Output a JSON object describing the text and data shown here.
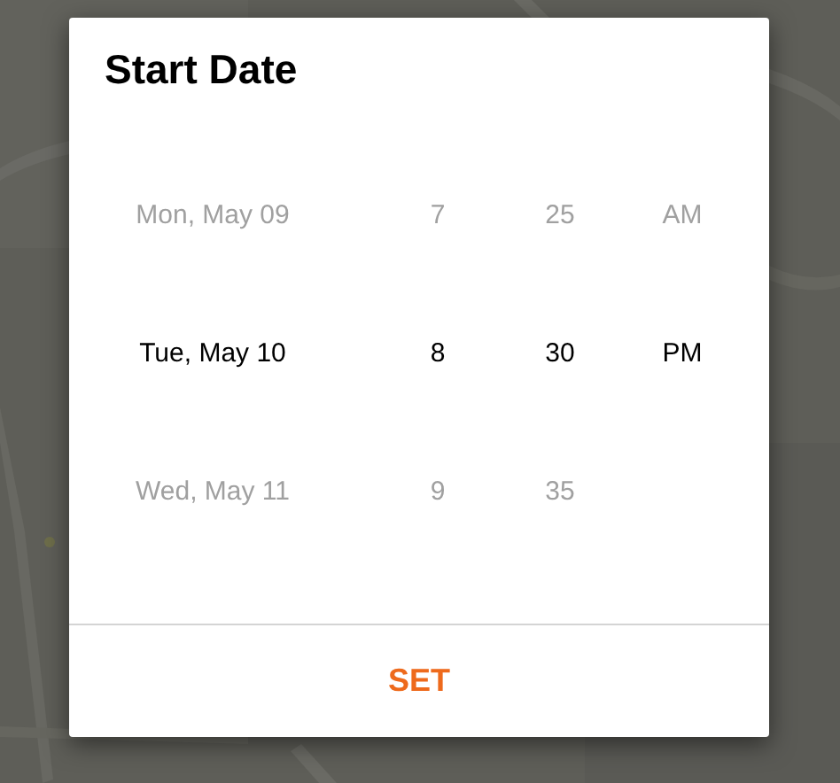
{
  "dialog": {
    "title": "Start Date",
    "picker_columns": [
      {
        "kind": "date",
        "items": [
          {
            "label": "Mon, May 09",
            "selected": false
          },
          {
            "label": "Tue, May 10",
            "selected": true
          },
          {
            "label": "Wed, May 11",
            "selected": false
          }
        ]
      },
      {
        "kind": "hour",
        "items": [
          {
            "label": "7",
            "selected": false
          },
          {
            "label": "8",
            "selected": true
          },
          {
            "label": "9",
            "selected": false
          }
        ]
      },
      {
        "kind": "minute",
        "items": [
          {
            "label": "25",
            "selected": false
          },
          {
            "label": "30",
            "selected": true
          },
          {
            "label": "35",
            "selected": false
          }
        ]
      },
      {
        "kind": "ampm",
        "items": [
          {
            "label": "AM",
            "selected": false
          },
          {
            "label": "PM",
            "selected": true
          }
        ]
      }
    ],
    "buttons": [
      "SET"
    ]
  }
}
